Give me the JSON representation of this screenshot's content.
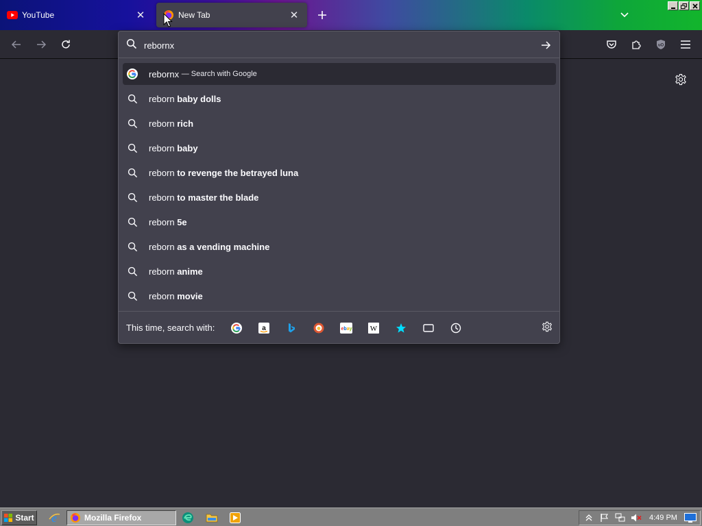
{
  "tabs": [
    {
      "title": "YouTube",
      "favicon": "youtube-icon"
    },
    {
      "title": "New Tab",
      "favicon": "firefox-icon",
      "active": true
    }
  ],
  "urlbar": {
    "value": "rebornx",
    "heuristic": {
      "query": "rebornx",
      "action": "— Search with Google",
      "icon": "google-icon"
    },
    "suggestions": [
      {
        "prefix": "reborn",
        "completion": "baby dolls"
      },
      {
        "prefix": "reborn",
        "completion": "rich"
      },
      {
        "prefix": "reborn",
        "completion": "baby"
      },
      {
        "prefix": "reborn",
        "completion": "to revenge the betrayed luna"
      },
      {
        "prefix": "reborn",
        "completion": "to master the blade"
      },
      {
        "prefix": "reborn",
        "completion": "5e"
      },
      {
        "prefix": "reborn",
        "completion": "as a vending machine"
      },
      {
        "prefix": "reborn",
        "completion": "anime"
      },
      {
        "prefix": "reborn",
        "completion": "movie"
      }
    ],
    "oneoff_label": "This time, search with:",
    "engines": [
      "google-icon",
      "amazon-icon",
      "bing-icon",
      "duckduckgo-icon",
      "ebay-icon",
      "wikipedia-icon",
      "bookmarks-icon",
      "tabs-icon",
      "history-icon"
    ]
  },
  "taskbar": {
    "start_label": "Start",
    "task_label": "Mozilla Firefox",
    "clock": "4:49 PM"
  },
  "colors": {
    "toolbar": "#2b2a33",
    "popup": "#42414d",
    "taskbar": "#7f7f7f"
  }
}
